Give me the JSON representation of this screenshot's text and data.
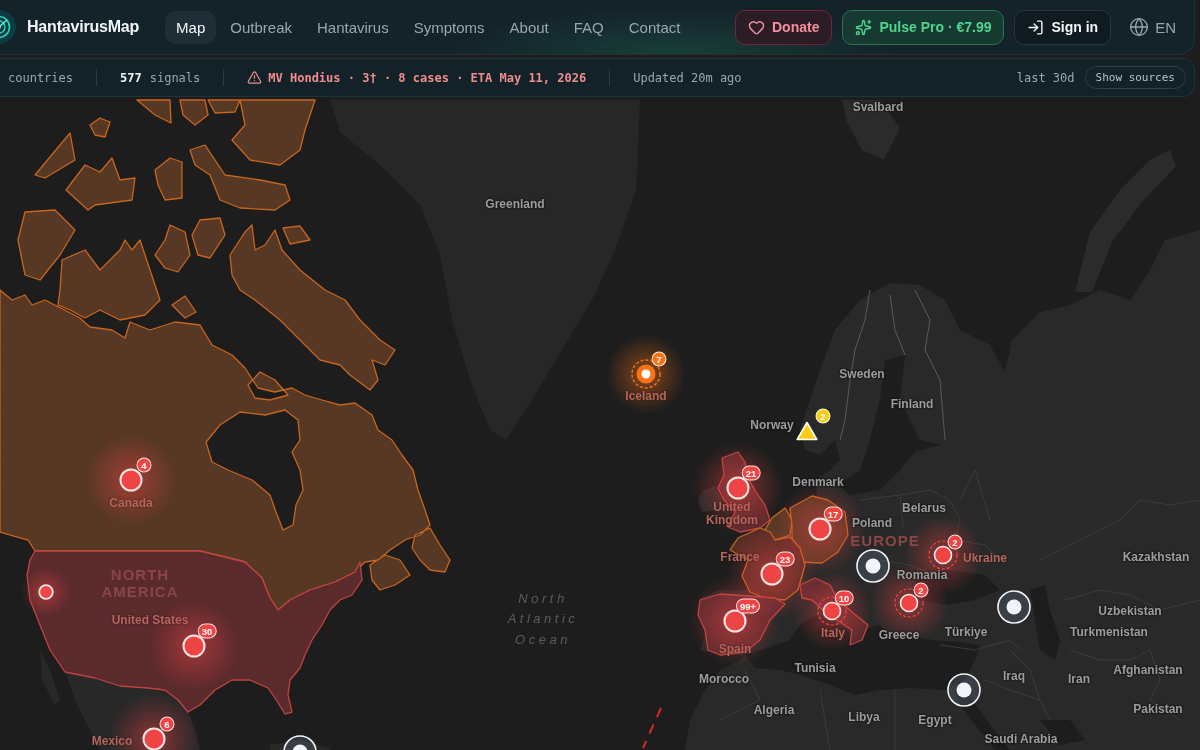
{
  "header": {
    "brand": "HantavirusMap",
    "nav": [
      {
        "label": "Map",
        "selected": true
      },
      {
        "label": "Outbreak",
        "selected": false
      },
      {
        "label": "Hantavirus",
        "selected": false
      },
      {
        "label": "Symptoms",
        "selected": false
      },
      {
        "label": "About",
        "selected": false
      },
      {
        "label": "FAQ",
        "selected": false
      },
      {
        "label": "Contact",
        "selected": false
      }
    ],
    "donate": "Donate",
    "pro": "Pulse Pro · €7.99",
    "sign_in": "Sign in",
    "language": "EN"
  },
  "stats_bar": {
    "countries_label": "countries",
    "signals_count": "577",
    "signals_label": "signals",
    "alert": "MV Hondius · 3† · 8 cases · ETA May 11, 2026",
    "updated": "Updated 20m ago",
    "range": "last 30d",
    "sources_button": "Show sources"
  },
  "map": {
    "labels": [
      {
        "text": "Svalbard",
        "kind": "place"
      },
      {
        "text": "Greenland",
        "kind": "place"
      },
      {
        "text": "Sweden",
        "kind": "place"
      },
      {
        "text": "Iceland",
        "kind": "tinted"
      },
      {
        "text": "Finland",
        "kind": "place"
      },
      {
        "text": "Norway",
        "kind": "place"
      },
      {
        "text": "Denmark",
        "kind": "place"
      },
      {
        "text": "Canada",
        "kind": "tinted"
      },
      {
        "text": "United Kingdom",
        "kind": "tinted"
      },
      {
        "text": "Belarus",
        "kind": "place"
      },
      {
        "text": "Poland",
        "kind": "place"
      },
      {
        "text": "EUROPE",
        "kind": "continent"
      },
      {
        "text": "France",
        "kind": "tinted"
      },
      {
        "text": "Ukraine",
        "kind": "tinted"
      },
      {
        "text": "Kazakhstan",
        "kind": "place"
      },
      {
        "text": "NORTH AMERICA",
        "kind": "continent"
      },
      {
        "text": "Romania",
        "kind": "place"
      },
      {
        "text": "North",
        "kind": "ocean"
      },
      {
        "text": "United States",
        "kind": "tinted"
      },
      {
        "text": "Atlantic",
        "kind": "ocean"
      },
      {
        "text": "Uzbekistan",
        "kind": "place"
      },
      {
        "text": "Ocean",
        "kind": "ocean"
      },
      {
        "text": "Italy",
        "kind": "tinted"
      },
      {
        "text": "Greece",
        "kind": "place"
      },
      {
        "text": "Türkiye",
        "kind": "place"
      },
      {
        "text": "Turkmenistan",
        "kind": "place"
      },
      {
        "text": "Spain",
        "kind": "tinted"
      },
      {
        "text": "Morocco",
        "kind": "place"
      },
      {
        "text": "Tunisia",
        "kind": "place"
      },
      {
        "text": "Iraq",
        "kind": "place"
      },
      {
        "text": "Iran",
        "kind": "place"
      },
      {
        "text": "Afghanistan",
        "kind": "place"
      },
      {
        "text": "Algeria",
        "kind": "place"
      },
      {
        "text": "Libya",
        "kind": "place"
      },
      {
        "text": "Egypt",
        "kind": "place"
      },
      {
        "text": "Pakistan",
        "kind": "place"
      },
      {
        "text": "Mexico",
        "kind": "tinted"
      },
      {
        "text": "Saudi Arabia",
        "kind": "place"
      }
    ],
    "markers": [
      {
        "kind": "hollow",
        "color": "#f97316",
        "count": "7"
      },
      {
        "kind": "alert",
        "color": "#facc15",
        "count": "2"
      },
      {
        "kind": "case",
        "color": "#ef4444",
        "count": "4"
      },
      {
        "kind": "case",
        "color": "#ef4444",
        "count": "21"
      },
      {
        "kind": "case",
        "color": "#ef4444",
        "count": "17"
      },
      {
        "kind": "ringed",
        "color": "#ef4444",
        "count": "2"
      },
      {
        "kind": "signal",
        "color": "#f1f5f9"
      },
      {
        "kind": "case",
        "color": "#ef4444",
        "count": "23"
      },
      {
        "kind": "dot",
        "color": "#ef4444"
      },
      {
        "kind": "ringed",
        "color": "#ef4444",
        "count": "2"
      },
      {
        "kind": "signal",
        "color": "#f1f5f9"
      },
      {
        "kind": "ringed",
        "color": "#ef4444",
        "count": "10"
      },
      {
        "kind": "case",
        "color": "#ef4444",
        "count": "99+"
      },
      {
        "kind": "case",
        "color": "#ef4444",
        "count": "30"
      },
      {
        "kind": "signal",
        "color": "#f1f5f9"
      },
      {
        "kind": "case",
        "color": "#ef4444",
        "count": "6"
      },
      {
        "kind": "signal",
        "color": "#f1f5f9"
      }
    ]
  }
}
